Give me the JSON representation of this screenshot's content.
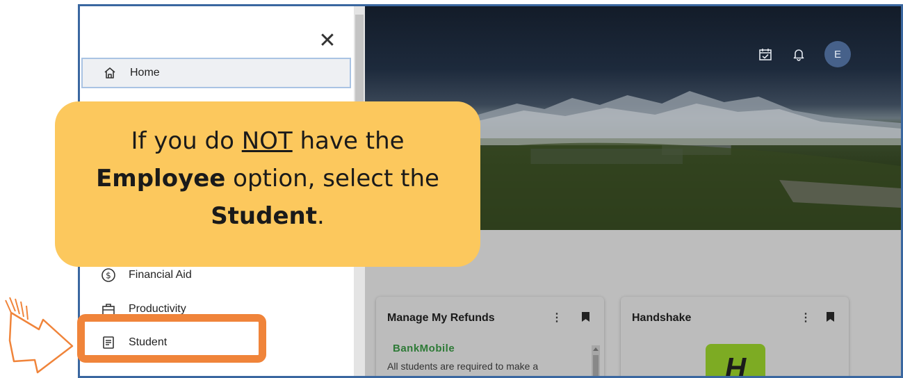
{
  "sidebar": {
    "close_label": "✕",
    "items": [
      {
        "label": "Home",
        "icon": "home-icon",
        "active": true
      },
      {
        "label": "Financial Aid",
        "icon": "dollar-circle-icon"
      },
      {
        "label": "Productivity",
        "icon": "briefcase-icon"
      },
      {
        "label": "Student",
        "icon": "book-icon"
      }
    ]
  },
  "header": {
    "avatar_letter": "E",
    "icons": [
      "calendar-check-icon",
      "bell-icon"
    ]
  },
  "cards": [
    {
      "title": "Manage My Refunds",
      "menu": "⋮",
      "brand": "BankMobile",
      "text": "All students are required to make a"
    },
    {
      "title": "Handshake",
      "menu": "⋮",
      "logo_letter": "H"
    }
  ],
  "callout": {
    "line1_pre": "If you do ",
    "line1_emph": "NOT",
    "line1_post": " have the",
    "line2_bold": "Employee",
    "line2_post": " option, select the",
    "line3_bold": "Student",
    "line3_post": "."
  },
  "colors": {
    "callout_bg": "#fcc85d",
    "highlight": "#f0843a",
    "frame": "#3a67a0",
    "avatar": "#46618a",
    "handshake_logo": "#7dab23"
  }
}
